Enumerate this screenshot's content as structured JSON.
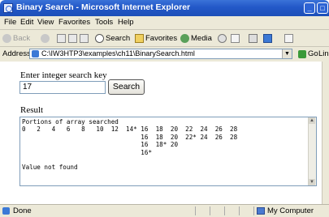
{
  "window": {
    "title": "Binary Search - Microsoft Internet Explorer",
    "buttons": [
      "_",
      "□"
    ]
  },
  "menu": [
    "File",
    "Edit",
    "View",
    "Favorites",
    "Tools",
    "Help"
  ],
  "toolbar": {
    "back": "Back",
    "search": "Search",
    "favorites": "Favorites",
    "media": "Media"
  },
  "address": {
    "label": "Address",
    "url": "C:\\IW3HTP3\\examples\\ch11\\BinarySearch.html",
    "go": "Go",
    "links": "Lin"
  },
  "form": {
    "prompt": "Enter integer search key",
    "input_value": "17",
    "button_label": "Search",
    "result_label": "Result"
  },
  "result": {
    "lines": [
      "Portions of array searched",
      "0   2   4   6   8   10  12  14* 16  18  20  22  24  26  28",
      "                                16  18  20  22* 24  26  28",
      "                                16  18* 20",
      "                                16*",
      "",
      "Value not found"
    ]
  },
  "status": {
    "left": "Done",
    "zone": "My Computer"
  },
  "colors": {
    "titlebar": "#2358c8",
    "chrome": "#ece9d8"
  }
}
